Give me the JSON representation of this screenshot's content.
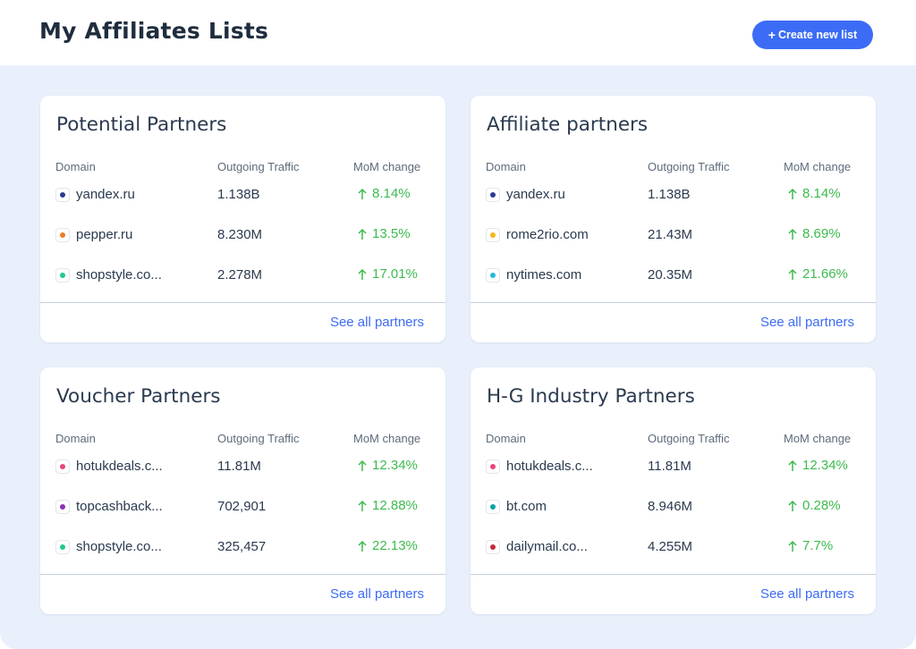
{
  "header": {
    "title": "My Affiliates Lists",
    "create_label": "Create new list",
    "create_icon": "plus-icon"
  },
  "colors": {
    "accent": "#3c6cf6",
    "positive": "#3dba4e",
    "background": "#e9f0fb"
  },
  "cards": [
    {
      "title": "Potential Partners",
      "columns": {
        "domain": "Domain",
        "traffic": "Outgoing Traffic",
        "mom": "MoM change"
      },
      "rows": [
        {
          "domain": "yandex.ru",
          "traffic": "1.138B",
          "mom": "8.14%",
          "color": "#2b3a8f"
        },
        {
          "domain": "pepper.ru",
          "traffic": "8.230M",
          "mom": "13.5%",
          "color": "#f07a23"
        },
        {
          "domain": "shopstyle.co...",
          "traffic": "2.278M",
          "mom": "17.01%",
          "color": "#1fc98a"
        }
      ],
      "see_all": "See all partners"
    },
    {
      "title": "Affiliate partners",
      "columns": {
        "domain": "Domain",
        "traffic": "Outgoing Traffic",
        "mom": "MoM change"
      },
      "rows": [
        {
          "domain": "yandex.ru",
          "traffic": "1.138B",
          "mom": "8.14%",
          "color": "#2b3a8f"
        },
        {
          "domain": "rome2rio.com",
          "traffic": "21.43M",
          "mom": "8.69%",
          "color": "#f5b718"
        },
        {
          "domain": "nytimes.com",
          "traffic": "20.35M",
          "mom": "21.66%",
          "color": "#26b9e0"
        }
      ],
      "see_all": "See all partners"
    },
    {
      "title": "Voucher Partners",
      "columns": {
        "domain": "Domain",
        "traffic": "Outgoing Traffic",
        "mom": "MoM change"
      },
      "rows": [
        {
          "domain": "hotukdeals.c...",
          "traffic": "11.81M",
          "mom": "12.34%",
          "color": "#e8457a"
        },
        {
          "domain": "topcashback...",
          "traffic": "702,901",
          "mom": "12.88%",
          "color": "#8a2fb0"
        },
        {
          "domain": "shopstyle.co...",
          "traffic": "325,457",
          "mom": "22.13%",
          "color": "#1fc98a"
        }
      ],
      "see_all": "See all partners"
    },
    {
      "title": "H-G Industry Partners",
      "columns": {
        "domain": "Domain",
        "traffic": "Outgoing Traffic",
        "mom": "MoM change"
      },
      "rows": [
        {
          "domain": "hotukdeals.c...",
          "traffic": "11.81M",
          "mom": "12.34%",
          "color": "#e8457a"
        },
        {
          "domain": "bt.com",
          "traffic": "8.946M",
          "mom": "0.28%",
          "color": "#0aa3a3"
        },
        {
          "domain": "dailymail.co...",
          "traffic": "4.255M",
          "mom": "7.7%",
          "color": "#c7283a"
        }
      ],
      "see_all": "See all partners"
    }
  ]
}
